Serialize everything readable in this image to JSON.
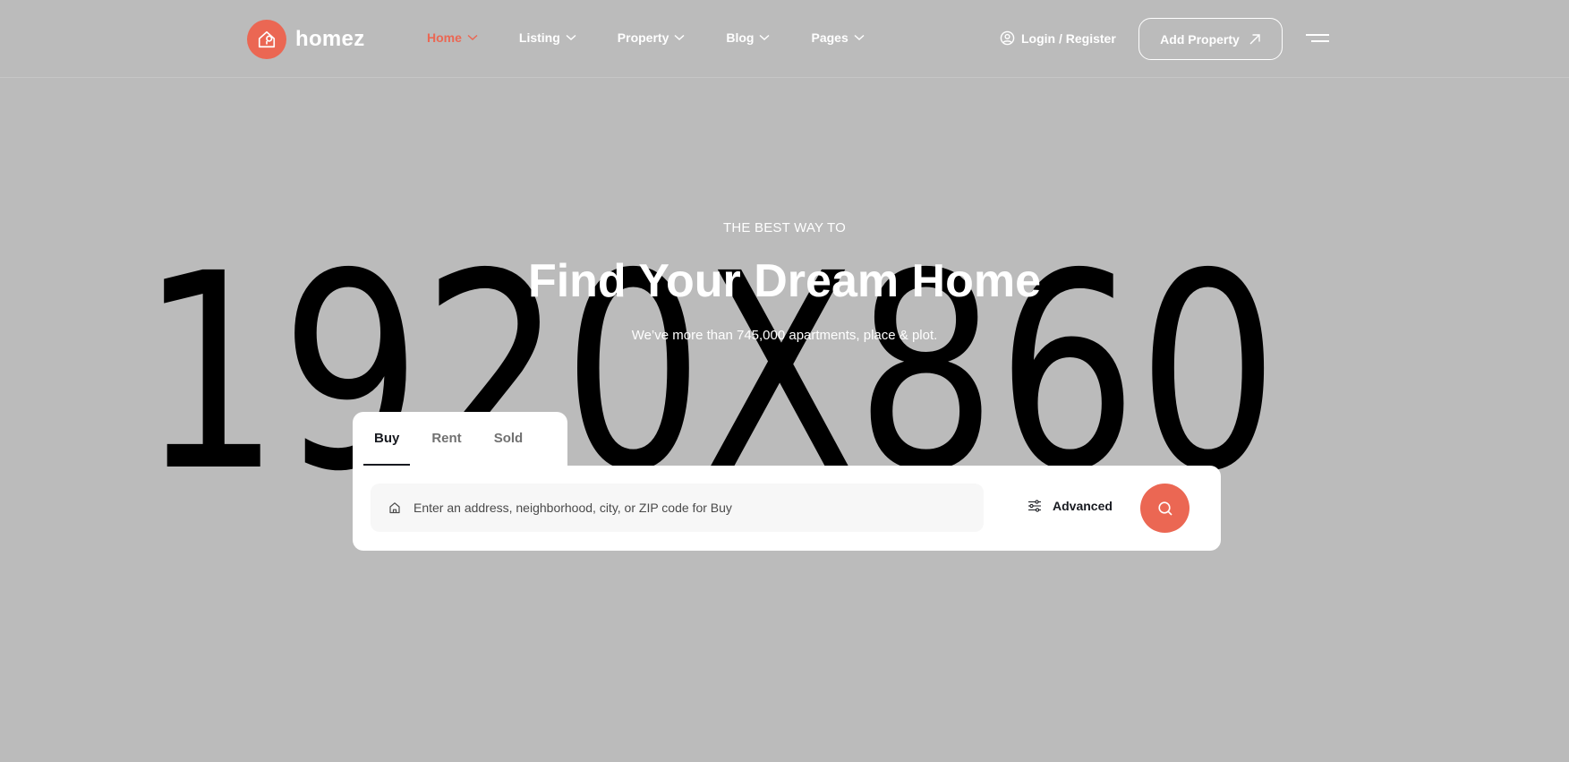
{
  "brand": {
    "name": "homez",
    "accent": "#eb6753"
  },
  "nav": {
    "items": [
      {
        "label": "Home",
        "active": true
      },
      {
        "label": "Listing",
        "active": false
      },
      {
        "label": "Property",
        "active": false
      },
      {
        "label": "Blog",
        "active": false
      },
      {
        "label": "Pages",
        "active": false
      }
    ]
  },
  "header": {
    "login_label": "Login / Register",
    "add_property_label": "Add Property",
    "icons": [
      "user-icon",
      "arrow-up-right-icon",
      "hamburger-icon"
    ]
  },
  "placeholder_image": {
    "text": "1920X860"
  },
  "hero": {
    "eyebrow": "THE BEST WAY TO",
    "title": "Find Your Dream Home",
    "subtitle": "We’ve more than 745,000 apartments, place & plot."
  },
  "search": {
    "tabs": [
      {
        "label": "Buy",
        "active": true
      },
      {
        "label": "Rent",
        "active": false
      },
      {
        "label": "Sold",
        "active": false
      }
    ],
    "placeholder": "Enter an address, neighborhood, city, or ZIP code for Buy",
    "value": "",
    "advanced_label": "Advanced"
  }
}
